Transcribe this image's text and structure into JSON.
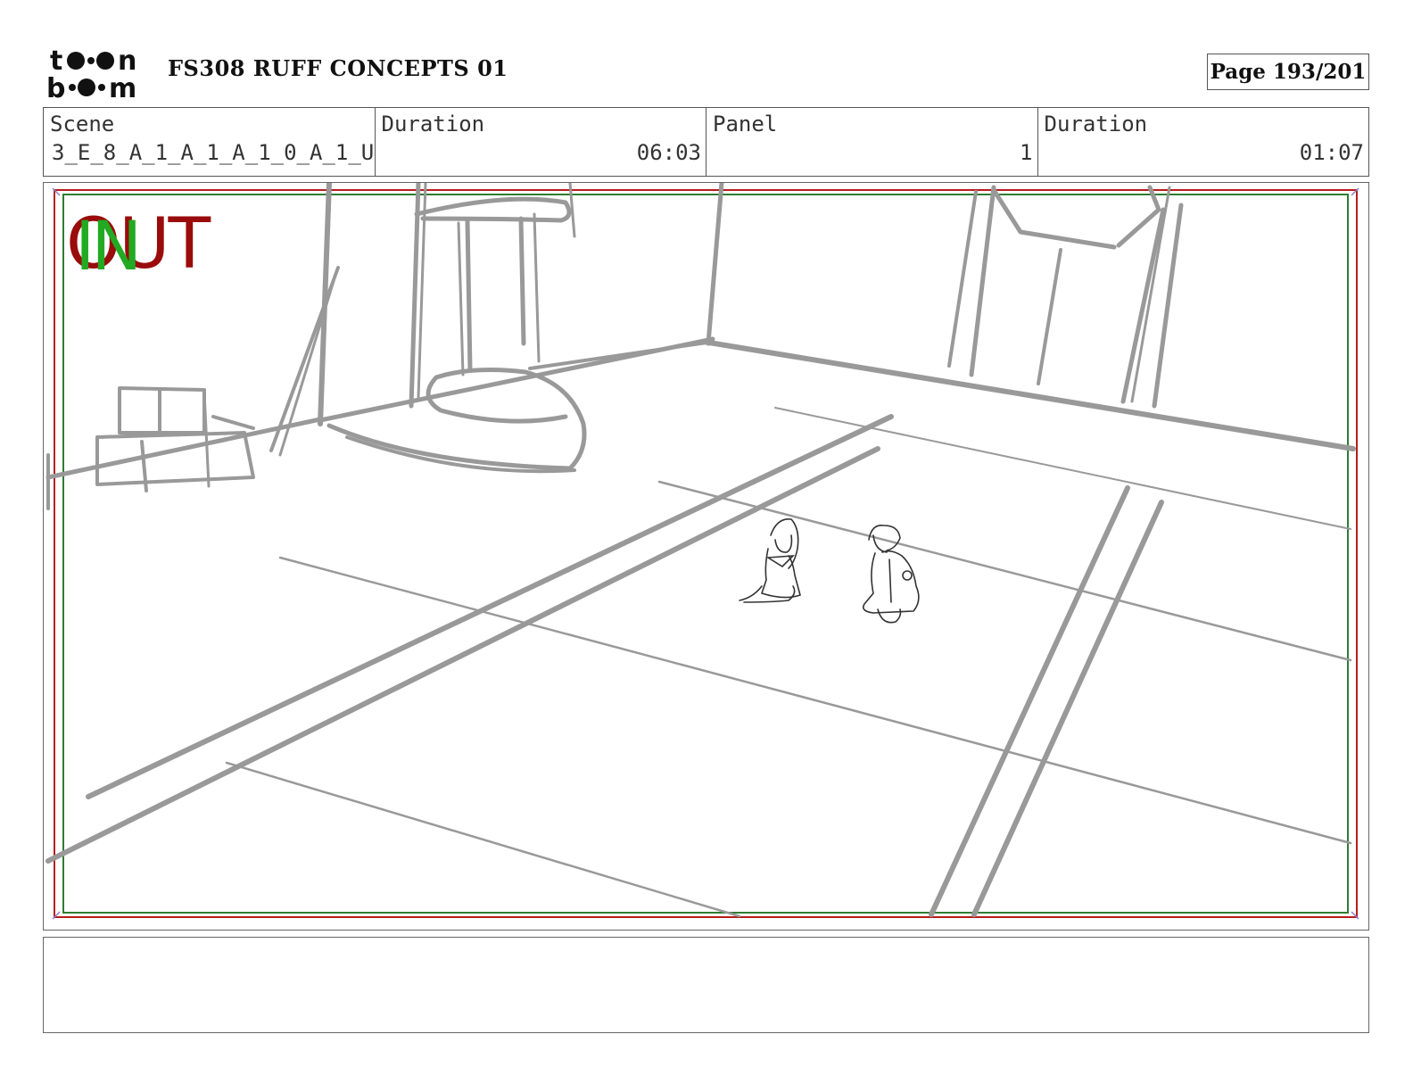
{
  "header": {
    "logo_text": "toon boom",
    "project_title": "FS308 RUFF CONCEPTS 01",
    "page_label": "Page 193/201"
  },
  "info": {
    "scene_label": "Scene",
    "scene_value": "3_E_8_A_1_A_1_A_1_0_A_1_U",
    "scene_duration_label": "Duration",
    "scene_duration_value": "06:03",
    "panel_label": "Panel",
    "panel_value": "1",
    "panel_duration_label": "Duration",
    "panel_duration_value": "01:07"
  },
  "panel": {
    "overlay_out": "OUT",
    "overlay_in": "IN",
    "colors": {
      "safe_frame": "#2e7d32",
      "camera_frame": "#b71c1c",
      "sketch": "#999999"
    }
  },
  "notes": {
    "text": ""
  }
}
